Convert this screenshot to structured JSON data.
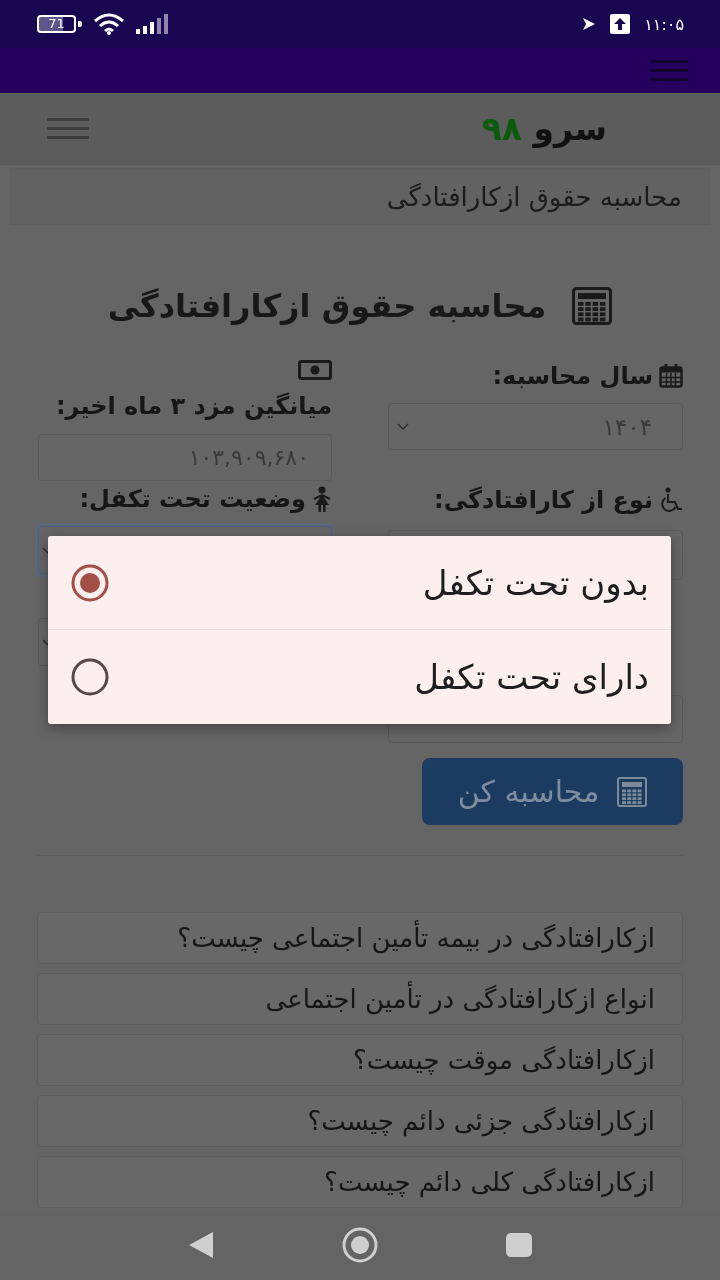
{
  "status_bar": {
    "battery": "71",
    "time": "۱۱:۰۵"
  },
  "site_header": {
    "logo_name": "سرو",
    "logo_number": "۹۸"
  },
  "breadcrumb": {
    "current": "محاسبه حقوق ازکارافتادگی"
  },
  "page_title": "محاسبه حقوق ازکارافتادگی",
  "form": {
    "columns": [
      [
        {
          "kind": "select",
          "label": "سال محاسبه:",
          "value": "۱۴۰۴",
          "focused": false
        },
        {
          "kind": "input",
          "label": "نوع از کارافتادگی:",
          "focused": false
        },
        {
          "kind": "input",
          "focused": false
        }
      ],
      [
        {
          "kind": "input",
          "label": "میانگین مزد ۳ ماه اخیر:",
          "value": "۱۰۳,۹۰۹,۶۸۰",
          "focused": false
        },
        {
          "kind": "select",
          "label": "وضعیت تحت تکفل:",
          "focused": true
        },
        {
          "kind": "select",
          "focused": false
        }
      ]
    ],
    "submit": "محاسبه کن"
  },
  "faq": [
    "ازکارافتادگی در بیمه تأمین اجتماعی چیست؟",
    "انواع ازکارافتادگی در تأمین اجتماعی",
    "ازکارافتادگی موقت چیست؟",
    "ازکارافتادگی جزئی دائم چیست؟",
    "ازکارافتادگی کلی دائم چیست؟"
  ],
  "dependency_dialog": {
    "options": [
      {
        "label": "بدون تحت تکفل",
        "selected": true
      },
      {
        "label": "دارای تحت تکفل",
        "selected": false
      }
    ]
  }
}
